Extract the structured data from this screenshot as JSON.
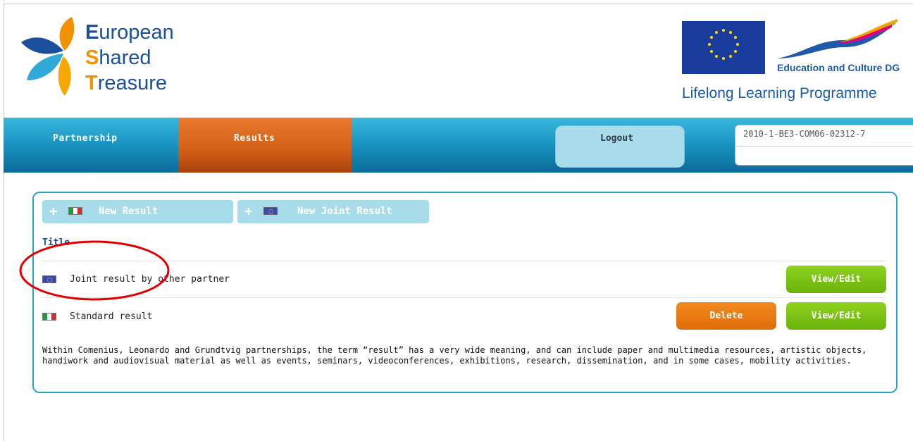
{
  "logo": {
    "line1_cap": "E",
    "line1_rest": "uropean",
    "line2_cap": "S",
    "line2_rest": "hared",
    "line3_cap": "T",
    "line3_rest": "reasure"
  },
  "eu": {
    "edu_label": "Education and Culture DG",
    "programme_label": "Lifelong Learning Programme"
  },
  "nav": {
    "partnership": "Partnership",
    "results": "Results",
    "logout": "Logout",
    "project_code": "2010-1-BE3-COM06-02312-7"
  },
  "actions": {
    "new_result": "New Result",
    "new_joint_result": "New Joint Result",
    "plus": "+"
  },
  "table": {
    "column_title": "Title",
    "rows": [
      {
        "flag": "eu-flag-icon",
        "title": "Joint result by other partner",
        "edit_label": "View/Edit"
      },
      {
        "flag": "italy-flag-icon",
        "title": "Standard result",
        "delete_label": "Delete",
        "edit_label": "View/Edit"
      }
    ]
  },
  "description": "Within Comenius, Leonardo and Grundtvig partnerships, the term “result” has a very wide meaning, and can include paper and multimedia resources, artistic objects, handiwork and audiovisual material as well as events, seminars, videoconferences, exhibitions, research, dissemination, and in some cases, mobility activities.",
  "colors": {
    "nav_blue": "#1b97c5",
    "results_orange": "#d5621a",
    "view_green": "#7cc215",
    "delete_orange": "#ee7d10",
    "annotation_red": "#e00000"
  }
}
